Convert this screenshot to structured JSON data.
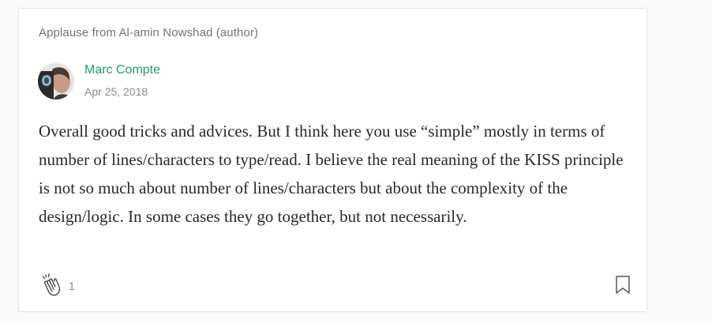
{
  "response": {
    "header_note": "Applause from Al-amin Nowshad (author)",
    "author": {
      "name": "Marc Compte",
      "date": "Apr 25, 2018"
    },
    "body": "Overall good tricks and advices. But I think here you use “simple” mostly in terms of number of lines/characters to type/read. I believe the real meaning of the KISS principle is not so much about number of lines/characters but about the complexity of the design/logic. In some cases they go together, but not necessarily.",
    "footer": {
      "clap_icon": "clap-icon",
      "clap_count": "1",
      "bookmark_icon": "bookmark-icon"
    }
  },
  "colors": {
    "accent": "#239a6f",
    "muted": "#737373",
    "text": "#292929"
  }
}
